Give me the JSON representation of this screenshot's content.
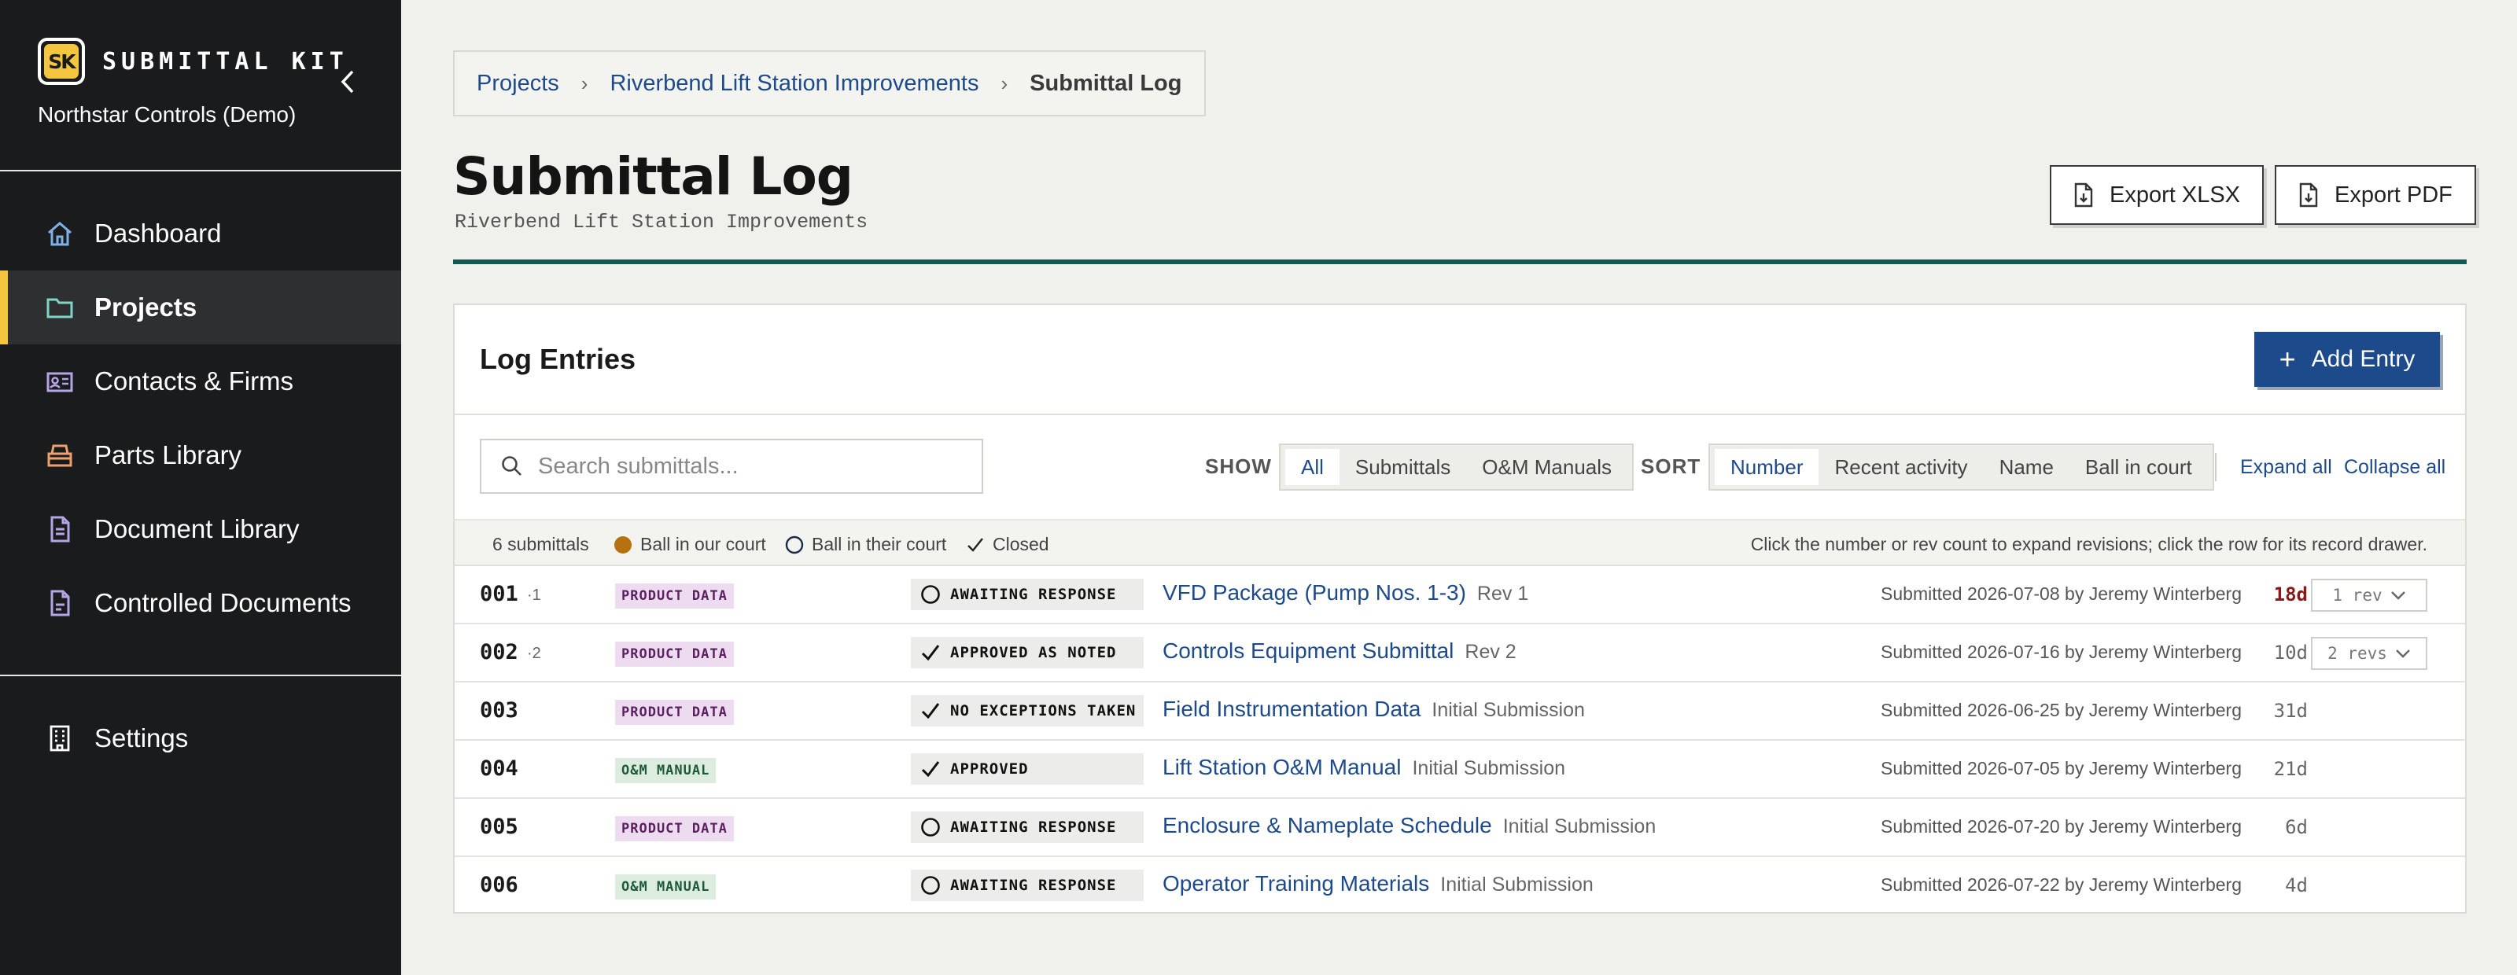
{
  "app": {
    "logo_text": "SK",
    "name": "SUBMITTAL KIT",
    "org": "Northstar Controls (Demo)"
  },
  "sidebar": {
    "items": [
      {
        "label": "Dashboard",
        "icon": "home-icon"
      },
      {
        "label": "Projects",
        "icon": "folder-icon",
        "active": true
      },
      {
        "label": "Contacts & Firms",
        "icon": "contact-card-icon"
      },
      {
        "label": "Parts Library",
        "icon": "parts-bin-icon"
      },
      {
        "label": "Document Library",
        "icon": "document-icon"
      },
      {
        "label": "Controlled Documents",
        "icon": "controlled-document-icon"
      }
    ],
    "settings_label": "Settings"
  },
  "breadcrumb": {
    "items": [
      "Projects",
      "Riverbend Lift Station Improvements"
    ],
    "current": "Submittal Log"
  },
  "page": {
    "title": "Submittal Log",
    "subtitle": "Riverbend Lift Station Improvements",
    "export_xlsx": "Export XLSX",
    "export_pdf": "Export PDF"
  },
  "colors": {
    "accent": "#1d4a8a",
    "brand_yellow": "#f4c53f",
    "rule_green": "#145a52",
    "ball_ours": "#b5720f",
    "overdue": "#8a1a1a"
  },
  "card": {
    "title": "Log Entries",
    "add_label": "Add Entry"
  },
  "toolbar": {
    "search_placeholder": "Search submittals...",
    "show_label": "SHOW",
    "show_options": [
      "All",
      "Submittals",
      "O&M Manuals"
    ],
    "show_selected": "All",
    "sort_label": "SORT",
    "sort_options": [
      "Number",
      "Recent activity",
      "Name",
      "Ball in court"
    ],
    "sort_selected": "Number",
    "expand_all": "Expand all",
    "collapse_all": "Collapse all"
  },
  "legend": {
    "count": "6 submittals",
    "ball_ours": "Ball in our court",
    "ball_theirs": "Ball in their court",
    "closed": "Closed",
    "hint": "Click the number or rev count to expand revisions; click the row for its record drawer."
  },
  "rows": [
    {
      "number": "001",
      "rev_sup": "·1",
      "type": "PRODUCT DATA",
      "type_kind": "pd",
      "status": "AWAITING RESPONSE",
      "status_icon": "circle-icon",
      "title": "VFD Package (Pump Nos. 1-3)",
      "rev": "Rev 1",
      "submitted": "Submitted 2026-07-08 by Jeremy Winterberg",
      "age": "18d",
      "overdue": true,
      "rev_button": "1 rev"
    },
    {
      "number": "002",
      "rev_sup": "·2",
      "type": "PRODUCT DATA",
      "type_kind": "pd",
      "status": "APPROVED AS NOTED",
      "status_icon": "check-icon",
      "title": "Controls Equipment Submittal",
      "rev": "Rev 2",
      "submitted": "Submitted 2026-07-16 by Jeremy Winterberg",
      "age": "10d",
      "overdue": false,
      "rev_button": "2 revs"
    },
    {
      "number": "003",
      "rev_sup": "",
      "type": "PRODUCT DATA",
      "type_kind": "pd",
      "status": "NO EXCEPTIONS TAKEN",
      "status_icon": "check-icon",
      "title": "Field Instrumentation Data",
      "rev": "Initial Submission",
      "submitted": "Submitted 2026-06-25 by Jeremy Winterberg",
      "age": "31d",
      "overdue": false,
      "rev_button": ""
    },
    {
      "number": "004",
      "rev_sup": "",
      "type": "O&M MANUAL",
      "type_kind": "om",
      "status": "APPROVED",
      "status_icon": "check-icon",
      "title": "Lift Station O&M Manual",
      "rev": "Initial Submission",
      "submitted": "Submitted 2026-07-05 by Jeremy Winterberg",
      "age": "21d",
      "overdue": false,
      "rev_button": ""
    },
    {
      "number": "005",
      "rev_sup": "",
      "type": "PRODUCT DATA",
      "type_kind": "pd",
      "status": "AWAITING RESPONSE",
      "status_icon": "circle-icon",
      "title": "Enclosure & Nameplate Schedule",
      "rev": "Initial Submission",
      "submitted": "Submitted 2026-07-20 by Jeremy Winterberg",
      "age": "6d",
      "overdue": false,
      "rev_button": ""
    },
    {
      "number": "006",
      "rev_sup": "",
      "type": "O&M MANUAL",
      "type_kind": "om",
      "status": "AWAITING RESPONSE",
      "status_icon": "circle-icon",
      "title": "Operator Training Materials",
      "rev": "Initial Submission",
      "submitted": "Submitted 2026-07-22 by Jeremy Winterberg",
      "age": "4d",
      "overdue": false,
      "rev_button": ""
    }
  ]
}
